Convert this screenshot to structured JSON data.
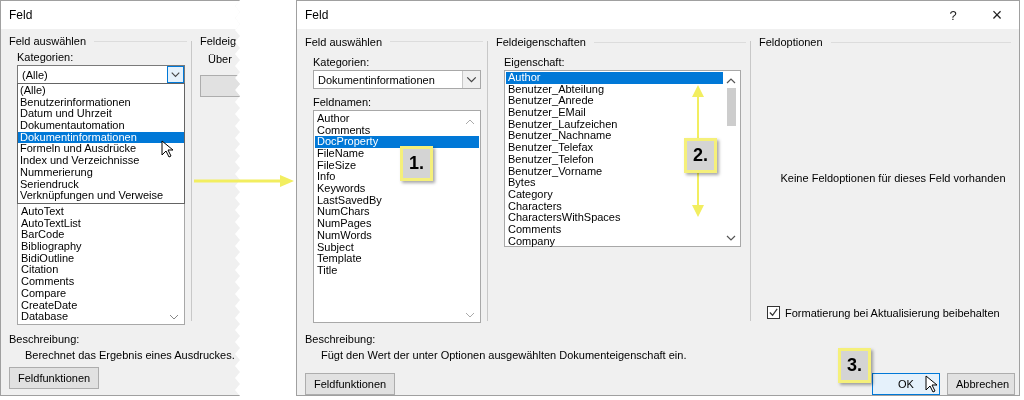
{
  "left_dialog": {
    "title": "Feld",
    "select_title": "Feld auswählen",
    "categories_label": "Kategorien:",
    "categories_value": "(Alle)",
    "category_options": [
      {
        "label": "(Alle)",
        "selected": false
      },
      {
        "label": "Benutzerinformationen",
        "selected": false
      },
      {
        "label": "Datum und Uhrzeit",
        "selected": false
      },
      {
        "label": "Dokumentautomation",
        "selected": false
      },
      {
        "label": "Dokumentinformationen",
        "selected": true
      },
      {
        "label": "Formeln und Ausdrücke",
        "selected": false
      },
      {
        "label": "Index und Verzeichnisse",
        "selected": false
      },
      {
        "label": "Nummerierung",
        "selected": false
      },
      {
        "label": "Seriendruck",
        "selected": false
      },
      {
        "label": "Verknüpfungen und Verweise",
        "selected": false
      }
    ],
    "field_names": [
      "AutoText",
      "AutoTextList",
      "BarCode",
      "Bibliography",
      "BidiOutline",
      "Citation",
      "Comments",
      "Compare",
      "CreateDate",
      "Database"
    ],
    "properties_title": "Feldeig",
    "properties_label": "Über",
    "description_label": "Beschreibung:",
    "description": "Berechnet das Ergebnis eines Ausdruckes.",
    "field_codes_button": "Feldfunktionen"
  },
  "right_dialog": {
    "title": "Feld",
    "help_button": "?",
    "close_button": "×",
    "select_title": "Feld auswählen",
    "categories_label": "Kategorien:",
    "categories_value": "Dokumentinformationen",
    "field_names_label": "Feldnamen:",
    "field_names": [
      {
        "label": "Author",
        "selected": false
      },
      {
        "label": "Comments",
        "selected": false
      },
      {
        "label": "DocProperty",
        "selected": true
      },
      {
        "label": "FileName",
        "selected": false
      },
      {
        "label": "FileSize",
        "selected": false
      },
      {
        "label": "Info",
        "selected": false
      },
      {
        "label": "Keywords",
        "selected": false
      },
      {
        "label": "LastSavedBy",
        "selected": false
      },
      {
        "label": "NumChars",
        "selected": false
      },
      {
        "label": "NumPages",
        "selected": false
      },
      {
        "label": "NumWords",
        "selected": false
      },
      {
        "label": "Subject",
        "selected": false
      },
      {
        "label": "Template",
        "selected": false
      },
      {
        "label": "Title",
        "selected": false
      }
    ],
    "properties_title": "Feldeigenschaften",
    "property_label": "Eigenschaft:",
    "properties": [
      {
        "label": "Author",
        "selected": true
      },
      {
        "label": "Benutzer_Abteilung",
        "selected": false
      },
      {
        "label": "Benutzer_Anrede",
        "selected": false
      },
      {
        "label": "Benutzer_EMail",
        "selected": false
      },
      {
        "label": "Benutzer_Laufzeichen",
        "selected": false
      },
      {
        "label": "Benutzer_Nachname",
        "selected": false
      },
      {
        "label": "Benutzer_Telefax",
        "selected": false
      },
      {
        "label": "Benutzer_Telefon",
        "selected": false
      },
      {
        "label": "Benutzer_Vorname",
        "selected": false
      },
      {
        "label": "Bytes",
        "selected": false
      },
      {
        "label": "Category",
        "selected": false
      },
      {
        "label": "Characters",
        "selected": false
      },
      {
        "label": "CharactersWithSpaces",
        "selected": false
      },
      {
        "label": "Comments",
        "selected": false
      },
      {
        "label": "Company",
        "selected": false
      }
    ],
    "options_title": "Feldoptionen",
    "no_options": "Keine Feldoptionen für dieses Feld vorhanden",
    "keep_formatting": {
      "label": "Formatierung bei Aktualisierung beibehalten",
      "checked": true
    },
    "description_label": "Beschreibung:",
    "description": "Fügt den Wert der unter Optionen ausgewählten Dokumenteigenschaft ein.",
    "field_codes_button": "Feldfunktionen",
    "buttons": [
      {
        "label": "OK",
        "default": true
      },
      {
        "label": "Abbrechen",
        "default": false
      }
    ]
  },
  "callouts": [
    "1.",
    "2.",
    "3."
  ]
}
